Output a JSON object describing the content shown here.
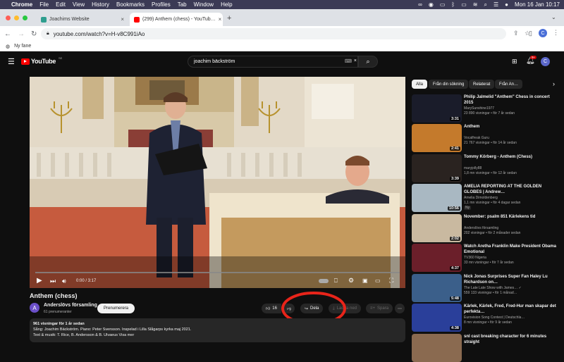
{
  "menubar": {
    "app": "Chrome",
    "items": [
      "File",
      "Edit",
      "View",
      "History",
      "Bookmarks",
      "Profiles",
      "Tab",
      "Window",
      "Help"
    ],
    "datetime": "Mon 16 Jan  10:17"
  },
  "tabs": [
    {
      "title": "Joachims Website",
      "close": "×"
    },
    {
      "title": "(299) Anthem (chess) - YouTub…",
      "close": "×"
    }
  ],
  "new_tab": "+",
  "address": {
    "url": "youtube.com/watch?v=H-v8C991iAo"
  },
  "bookmarks": {
    "item": "Ny fane"
  },
  "profile_initial": "C",
  "youtube": {
    "logo": "YouTube",
    "logo_region": "SE",
    "search_value": "joachim bäckström",
    "notif_count": "9+",
    "avatar": "C"
  },
  "player": {
    "time": "0:00 / 3:17",
    "progress": 0.0
  },
  "video": {
    "title": "Anthem (chess)",
    "channel": "Anderslövs församling",
    "subscribers": "61 prenumeranter",
    "channel_initial": "A",
    "subscribe": "Prenumerera",
    "likes": "16",
    "share": "Dela",
    "download": "Ladda ned",
    "save": "Spara",
    "more": "⋯",
    "desc_line1": "961 visningar  för 1 år sedan",
    "desc_line2": "Sång: Joachim Bäckström. Piano: Peter Svensson. Inspelad i Lilla Slågarps kyrka maj 2021.",
    "desc_line3": "Text & musik: T. Rice, B. Andersson & B. Ulvaeus Visa mer"
  },
  "chips": [
    "Alla",
    "Från din sökning",
    "Relaterat",
    "Från An…"
  ],
  "recommendations": [
    {
      "title": "Philip Jalmelid \"Anthem\" Chess in concert 2015",
      "channel": "MarySunshine1977",
      "meta": "23 890 visningar • för 7 år sedan",
      "duration": "3:31",
      "color": "#1a1c2a"
    },
    {
      "title": "Anthem",
      "channel": "Vocalfreak Guru",
      "meta": "21 767 visningar • för 14 år sedan",
      "duration": "2:41",
      "color": "#c47a2c"
    },
    {
      "title": "Tommy Körberg - Anthem (Chess)",
      "channel": "maryjolly88",
      "meta": "1,8 mn visningar • för 12 år sedan",
      "duration": "3:39",
      "color": "#2a2320"
    },
    {
      "title": "AMELIA REPORTING AT THE GOLDEN GLOBES | Andrew…",
      "channel": "Amelia Dimoldenberg",
      "meta": "1,1 mn visningar • för 4 dagar sedan",
      "duration": "10:56",
      "color": "#a9b8c2",
      "badge": "Ny"
    },
    {
      "title": "November: psalm 851 Kärlekens tid",
      "channel": "Anderslövs församling",
      "meta": "202 visningar • för 2 månader sedan",
      "duration": "2:02",
      "color": "#c9b9a0"
    },
    {
      "title": "Watch Aretha Franklin Make President Obama Emotional",
      "channel": "TV360 Nigeria",
      "meta": "33 mn visningar • för 7 år sedan",
      "duration": "4:37",
      "color": "#6b1f2a"
    },
    {
      "title": "Nick Jonas Surprises Super Fan Haley Lu Richardson on…",
      "channel": "The Late Late Show with James… ✓",
      "meta": "559 133 visningar • för 1 månad…",
      "duration": "5:48",
      "color": "#3b5f8a"
    },
    {
      "title": "Kärlek, Kärlek, Fred, Fred-Hur man skapar det perfekta…",
      "channel": "Eurovision Song Contest | Deutschla…",
      "meta": "8 mn visningar • för 9 år sedan",
      "duration": "4:38",
      "color": "#2a3f9a"
    },
    {
      "title": "snl cast breaking character for 6 minutes straight",
      "channel": "",
      "meta": "",
      "duration": "",
      "color": "#8a6a50"
    }
  ]
}
